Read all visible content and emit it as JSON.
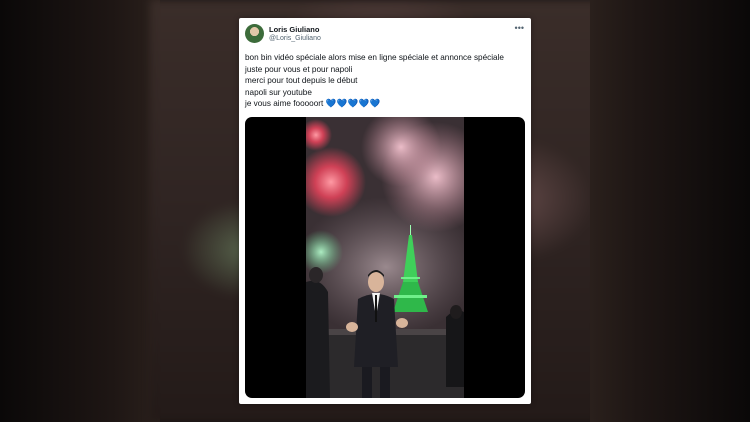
{
  "tweet": {
    "author_name": "Loris Giuliano",
    "author_handle": "@Loris_Giuliano",
    "more_icon": "more-horizontal-icon",
    "lines": [
      "bon bin vidéo spéciale alors mise en ligne spéciale et annonce spéciale",
      "juste pour vous et pour napoli",
      "merci pour tout depuis le début",
      "napoli sur youtube",
      "je vous aime fooooort"
    ],
    "emoji_hearts": "💙💙💙💙💙"
  },
  "colors": {
    "heart_blue": "#5aa9e6",
    "text_primary": "#0f1419",
    "text_secondary": "#536471",
    "tower_green": "#3fcf5a"
  }
}
